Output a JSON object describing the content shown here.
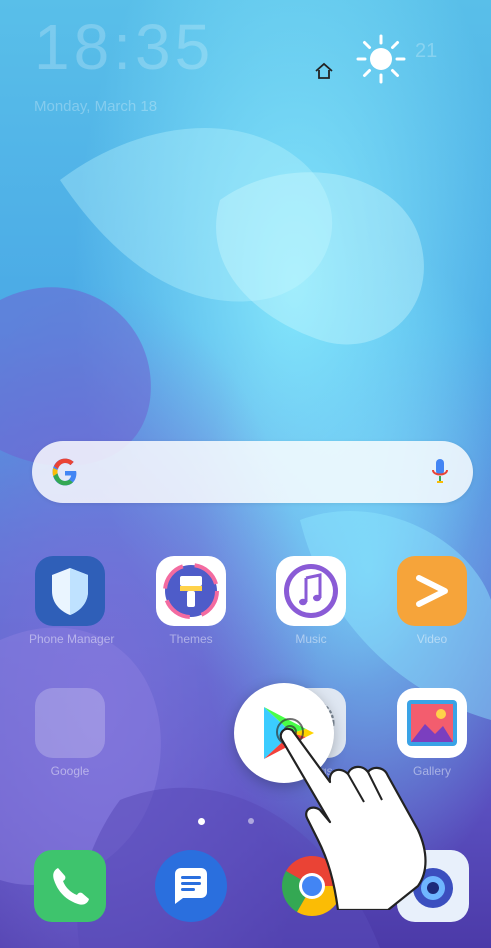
{
  "status": {
    "time": "18:35",
    "date": "Monday, March 18",
    "temperature": "21",
    "weather_icon": "sun-icon"
  },
  "search": {
    "logo": "google-g-icon",
    "voice_icon": "mic-icon"
  },
  "apps_row1": [
    {
      "label": "Phone Manager",
      "icon": "shield-icon"
    },
    {
      "label": "Themes",
      "icon": "paintbrush-icon"
    },
    {
      "label": "Music",
      "icon": "music-note-icon"
    },
    {
      "label": "Video",
      "icon": "play-icon"
    }
  ],
  "apps_row2": [
    {
      "label": "Google",
      "icon": "folder-icon"
    },
    {
      "label": "Settings",
      "icon": "gear-icon"
    },
    {
      "label": "Gallery",
      "icon": "gallery-icon"
    }
  ],
  "dragging_app": {
    "icon": "play-store-icon"
  },
  "page_indicator": {
    "pages": 2,
    "current": 1
  },
  "dock": [
    {
      "icon": "phone-icon"
    },
    {
      "icon": "messages-icon"
    },
    {
      "icon": "chrome-icon"
    },
    {
      "icon": "camera-icon"
    }
  ],
  "colors": {
    "accent_orange": "#f6a43a",
    "phone_green": "#3ec46d",
    "messages_blue": "#2a6fde",
    "sky_blue": "#5fd3f5"
  }
}
